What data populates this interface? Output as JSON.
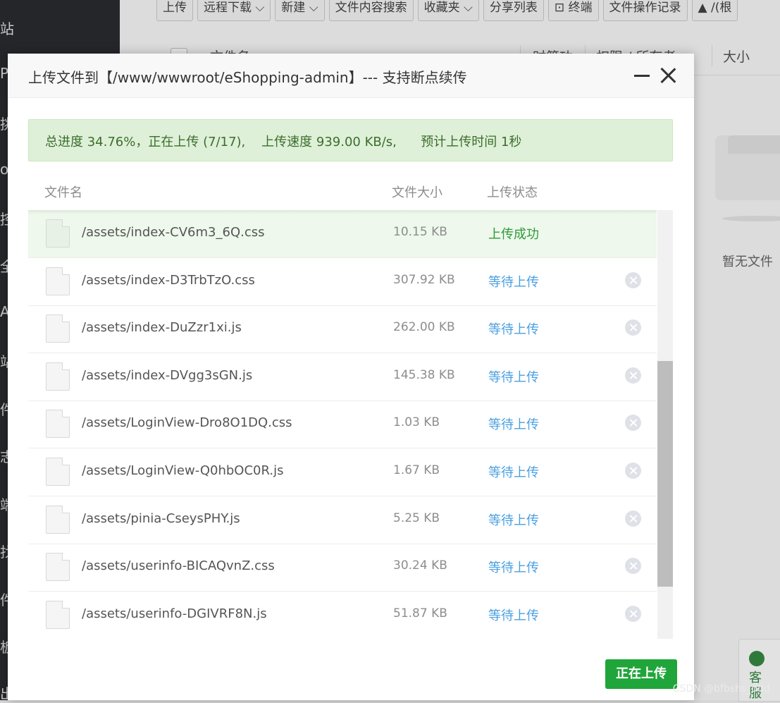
{
  "background": {
    "sidebar_chars": [
      "站",
      "P",
      "挑",
      "o",
      "控",
      "全",
      "A",
      "站",
      "件",
      "志",
      "端",
      "找",
      "件",
      "板",
      "出"
    ],
    "toolbar_buttons": [
      "上传",
      "远程下载 ⌵",
      "新建 ⌵",
      "文件内容搜索",
      "收藏夹 ⌵",
      "分享列表",
      "⊡ 终端",
      "文件操作记录",
      "▲ /(根"
    ],
    "table_columns": [
      "文件名",
      "时简功",
      "权限 / 所有者",
      "大小"
    ],
    "empty_text": "暂无文件",
    "help_text": "客服"
  },
  "modal": {
    "title": "上传文件到【/www/wwwroot/eShopping-admin】--- 支持断点续传",
    "progress_text": "总进度 34.76%，正在上传 (7/17),    上传速度 939.00 KB/s,      预计上传时间 1秒",
    "progress_percent": 34.76,
    "columns": {
      "name": "文件名",
      "size": "文件大小",
      "status": "上传状态"
    },
    "files": [
      {
        "name": "/assets/index-CV6m3_6Q.css",
        "size": "10.15 KB",
        "status": "上传成功",
        "state": "done"
      },
      {
        "name": "/assets/index-D3TrbTzO.css",
        "size": "307.92 KB",
        "status": "等待上传",
        "state": "waiting"
      },
      {
        "name": "/assets/index-DuZzr1xi.js",
        "size": "262.00 KB",
        "status": "等待上传",
        "state": "waiting"
      },
      {
        "name": "/assets/index-DVgg3sGN.js",
        "size": "145.38 KB",
        "status": "等待上传",
        "state": "waiting"
      },
      {
        "name": "/assets/LoginView-Dro8O1DQ.css",
        "size": "1.03 KB",
        "status": "等待上传",
        "state": "waiting"
      },
      {
        "name": "/assets/LoginView-Q0hbOC0R.js",
        "size": "1.67 KB",
        "status": "等待上传",
        "state": "waiting"
      },
      {
        "name": "/assets/pinia-CseysPHY.js",
        "size": "5.25 KB",
        "status": "等待上传",
        "state": "waiting"
      },
      {
        "name": "/assets/userinfo-BICAQvnZ.css",
        "size": "30.24 KB",
        "status": "等待上传",
        "state": "waiting"
      },
      {
        "name": "/assets/userinfo-DGIVRF8N.js",
        "size": "51.87 KB",
        "status": "等待上传",
        "state": "waiting"
      }
    ],
    "upload_button": "正在上传"
  },
  "watermark": "CSDN @bfbshs_ddd",
  "colors": {
    "success_green": "#20a53a",
    "waiting_blue": "#4a9fe0",
    "progress_bg": "#dff0d8",
    "progress_text": "#3b6e2d"
  },
  "icons": {
    "minimize": "minimize-icon",
    "close": "close-icon",
    "file": "file-icon",
    "remove": "remove-circle-icon"
  }
}
